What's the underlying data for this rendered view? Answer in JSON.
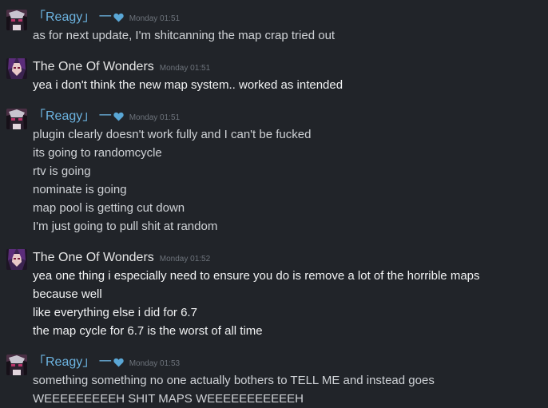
{
  "messages": [
    {
      "author": "「Reagy」 一",
      "author_style": "reagy",
      "has_heart": true,
      "time": "Monday 01:51",
      "lines": [
        "as for next update, I'm shitcanning the map crap tried out"
      ]
    },
    {
      "author": "The One Of Wonders",
      "author_style": "wonders",
      "has_heart": false,
      "time": "Monday 01:51",
      "lines": [
        "yea i don't think the new map system.. worked as intended"
      ]
    },
    {
      "author": "「Reagy」 一",
      "author_style": "reagy",
      "has_heart": true,
      "time": "Monday 01:51",
      "lines": [
        "plugin clearly doesn't work fully and I can't be fucked",
        "its going to randomcycle",
        "rtv is going",
        "nominate is going",
        "map pool is getting cut down",
        "I'm just going to pull shit at random"
      ]
    },
    {
      "author": "The One Of Wonders",
      "author_style": "wonders",
      "has_heart": false,
      "time": "Monday 01:52",
      "lines": [
        "yea one thing i especially need to ensure you do is remove a lot of the horrible maps",
        "because well",
        "like everything else i did for 6.7",
        "the map cycle for 6.7 is the worst of all time"
      ]
    },
    {
      "author": "「Reagy」 一",
      "author_style": "reagy",
      "has_heart": true,
      "time": "Monday 01:53",
      "lines": [
        "something something no one actually bothers to TELL ME and instead goes",
        "WEEEEEEEEEH SHIT MAPS WEEEEEEEEEEEH"
      ]
    }
  ],
  "colors": {
    "background": "#212429",
    "reagy_name": "#6cb3e0",
    "heart": "#5aa7d6",
    "wonders_name": "#e6e6e6",
    "timestamp": "#6d737b",
    "reagy_text": "#cfd2d6",
    "wonders_text": "#f2f3f4"
  },
  "icons": {
    "reagy_avatar": "anime-avatar-icon",
    "wonders_avatar": "character-avatar-icon",
    "heart": "heart-icon"
  }
}
